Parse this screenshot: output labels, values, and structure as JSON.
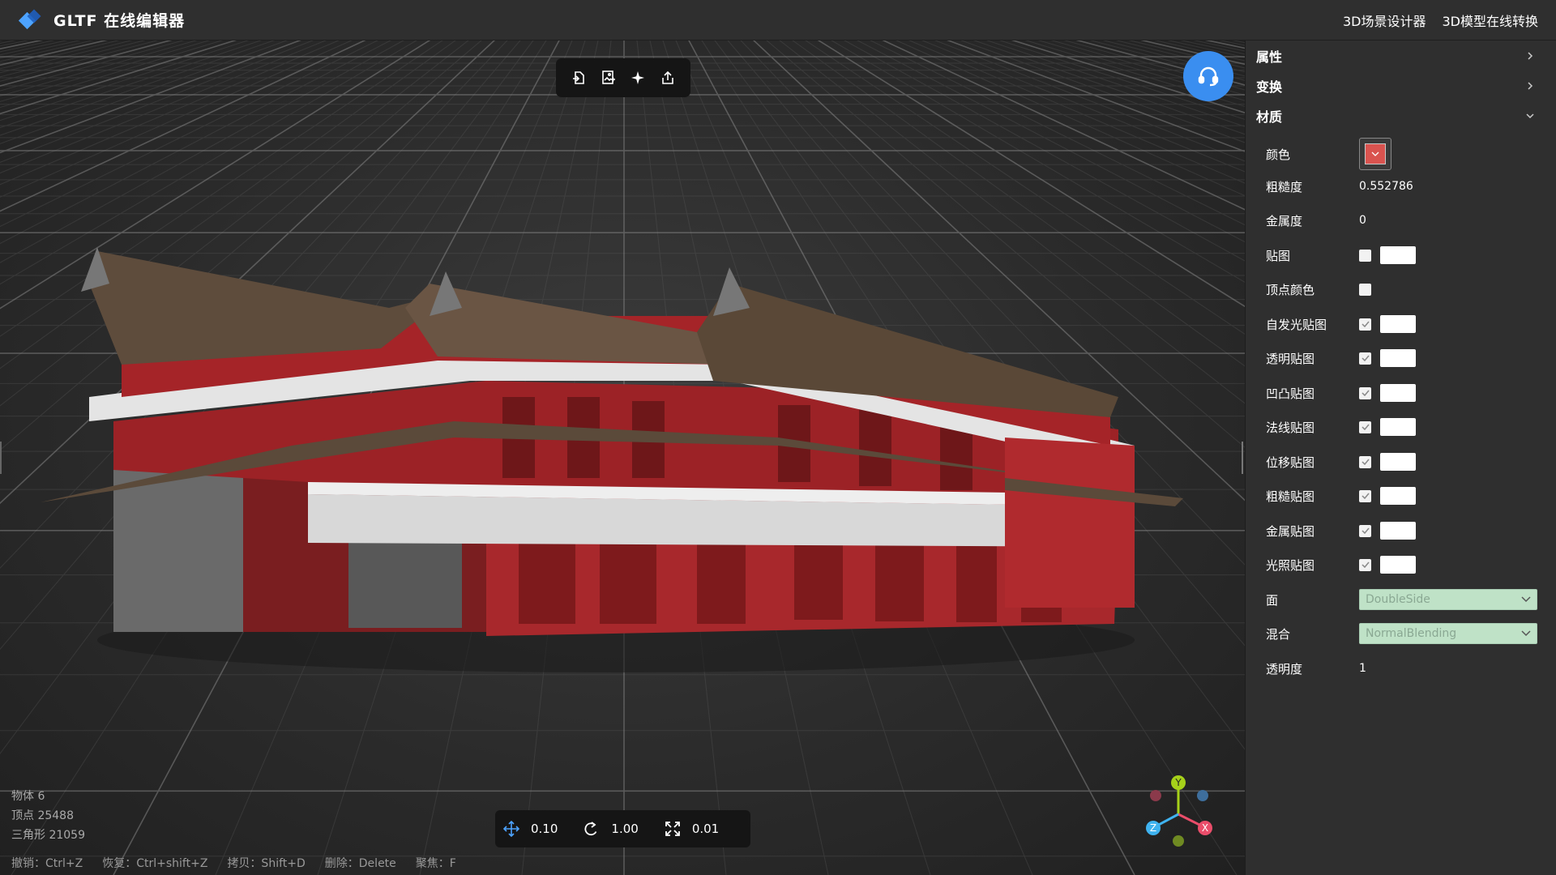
{
  "header": {
    "title": "GLTF 在线编辑器",
    "links": [
      "3D场景设计器",
      "3D模型在线转换"
    ]
  },
  "viewport": {
    "toolbar_icons": [
      "import-file-icon",
      "import-image-icon",
      "light-sparkle-icon",
      "export-share-icon"
    ],
    "stats": {
      "objects": "物体 6",
      "vertices": "顶点 25488",
      "triangles": "三角形 21059"
    },
    "transform": {
      "move": "0.10",
      "rotate": "1.00",
      "scale": "0.01"
    },
    "shortcuts": [
      "撤销：Ctrl+Z",
      "恢复：Ctrl+shift+Z",
      "拷贝：Shift+D",
      "删除：Delete",
      "聚焦：F"
    ],
    "axis_labels": {
      "y": "Y",
      "x": "X",
      "z": "Z"
    }
  },
  "panel": {
    "sections": [
      {
        "label": "属性",
        "expanded": false
      },
      {
        "label": "变换",
        "expanded": false
      },
      {
        "label": "材质",
        "expanded": true
      }
    ],
    "material": {
      "color_label": "颜色",
      "color_value": "#d9534f",
      "roughness_label": "粗糙度",
      "roughness": "0.552786",
      "metalness_label": "金属度",
      "metalness": "0",
      "maps": [
        {
          "label": "贴图",
          "checked": false,
          "swatch": true
        },
        {
          "label": "顶点颜色",
          "checked": false,
          "swatch": false
        },
        {
          "label": "自发光贴图",
          "checked": true,
          "swatch": true
        },
        {
          "label": "透明贴图",
          "checked": true,
          "swatch": true
        },
        {
          "label": "凹凸贴图",
          "checked": true,
          "swatch": true
        },
        {
          "label": "法线贴图",
          "checked": true,
          "swatch": true
        },
        {
          "label": "位移贴图",
          "checked": true,
          "swatch": true
        },
        {
          "label": "粗糙贴图",
          "checked": true,
          "swatch": true
        },
        {
          "label": "金属贴图",
          "checked": true,
          "swatch": true
        },
        {
          "label": "光照贴图",
          "checked": true,
          "swatch": true
        }
      ],
      "side_label": "面",
      "side_value": "DoubleSide",
      "blending_label": "混合",
      "blending_value": "NormalBlending",
      "opacity_label": "透明度",
      "opacity": "1"
    }
  },
  "colors": {
    "accent": "#3a8ef0",
    "header_bg": "#2f2f2f",
    "panel_bg": "#2f2f2f",
    "select_bg": "#bfe2c7"
  }
}
